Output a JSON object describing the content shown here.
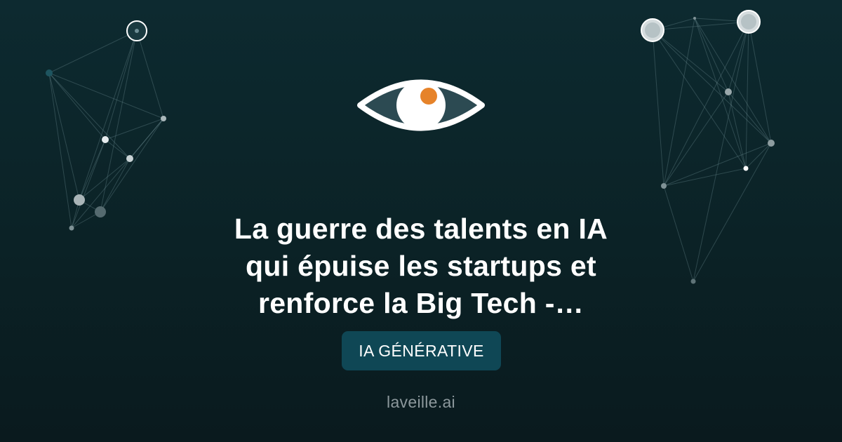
{
  "logo": {
    "icon": "eye-icon",
    "pupil_color": "#e6832a",
    "iris_color": "#ffffff",
    "outline_color": "#ffffff"
  },
  "article": {
    "title_lines": [
      "La guerre des talents en IA",
      "qui épuise les startups et",
      "renforce la Big Tech -…"
    ]
  },
  "category": {
    "label": "IA GÉNÉRATIVE"
  },
  "site": {
    "name": "laveille.ai"
  },
  "colors": {
    "background": "#0b2226",
    "badge": "#0f4755",
    "accent": "#e6832a",
    "muted_text": "#8c989c"
  }
}
